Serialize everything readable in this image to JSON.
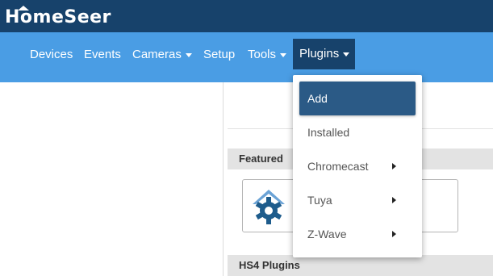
{
  "app": {
    "logo_text": "HomeSeer"
  },
  "nav": {
    "items": [
      {
        "label": "Devices"
      },
      {
        "label": "Events"
      },
      {
        "label": "Cameras"
      },
      {
        "label": "Setup"
      },
      {
        "label": "Tools"
      },
      {
        "label": "Plugins"
      }
    ]
  },
  "plugins_menu": {
    "items": [
      {
        "label": "Add"
      },
      {
        "label": "Installed"
      },
      {
        "label": "Chromecast"
      },
      {
        "label": "Tuya"
      },
      {
        "label": "Z-Wave"
      }
    ]
  },
  "sections": {
    "featured": "Featured",
    "hs4_plugins": "HS4 Plugins"
  },
  "colors": {
    "topbar": "#17426b",
    "navbar": "#4a9de4",
    "active_item": "#2b5a86",
    "section_bg": "#e3e3e3",
    "logo_blue": "#1e5c8c",
    "logo_light": "#6ba3d6"
  },
  "icons": {
    "caret": "caret-down-icon",
    "submenu": "caret-right-icon",
    "plugin_logo": "homeseer-gear-logo"
  }
}
